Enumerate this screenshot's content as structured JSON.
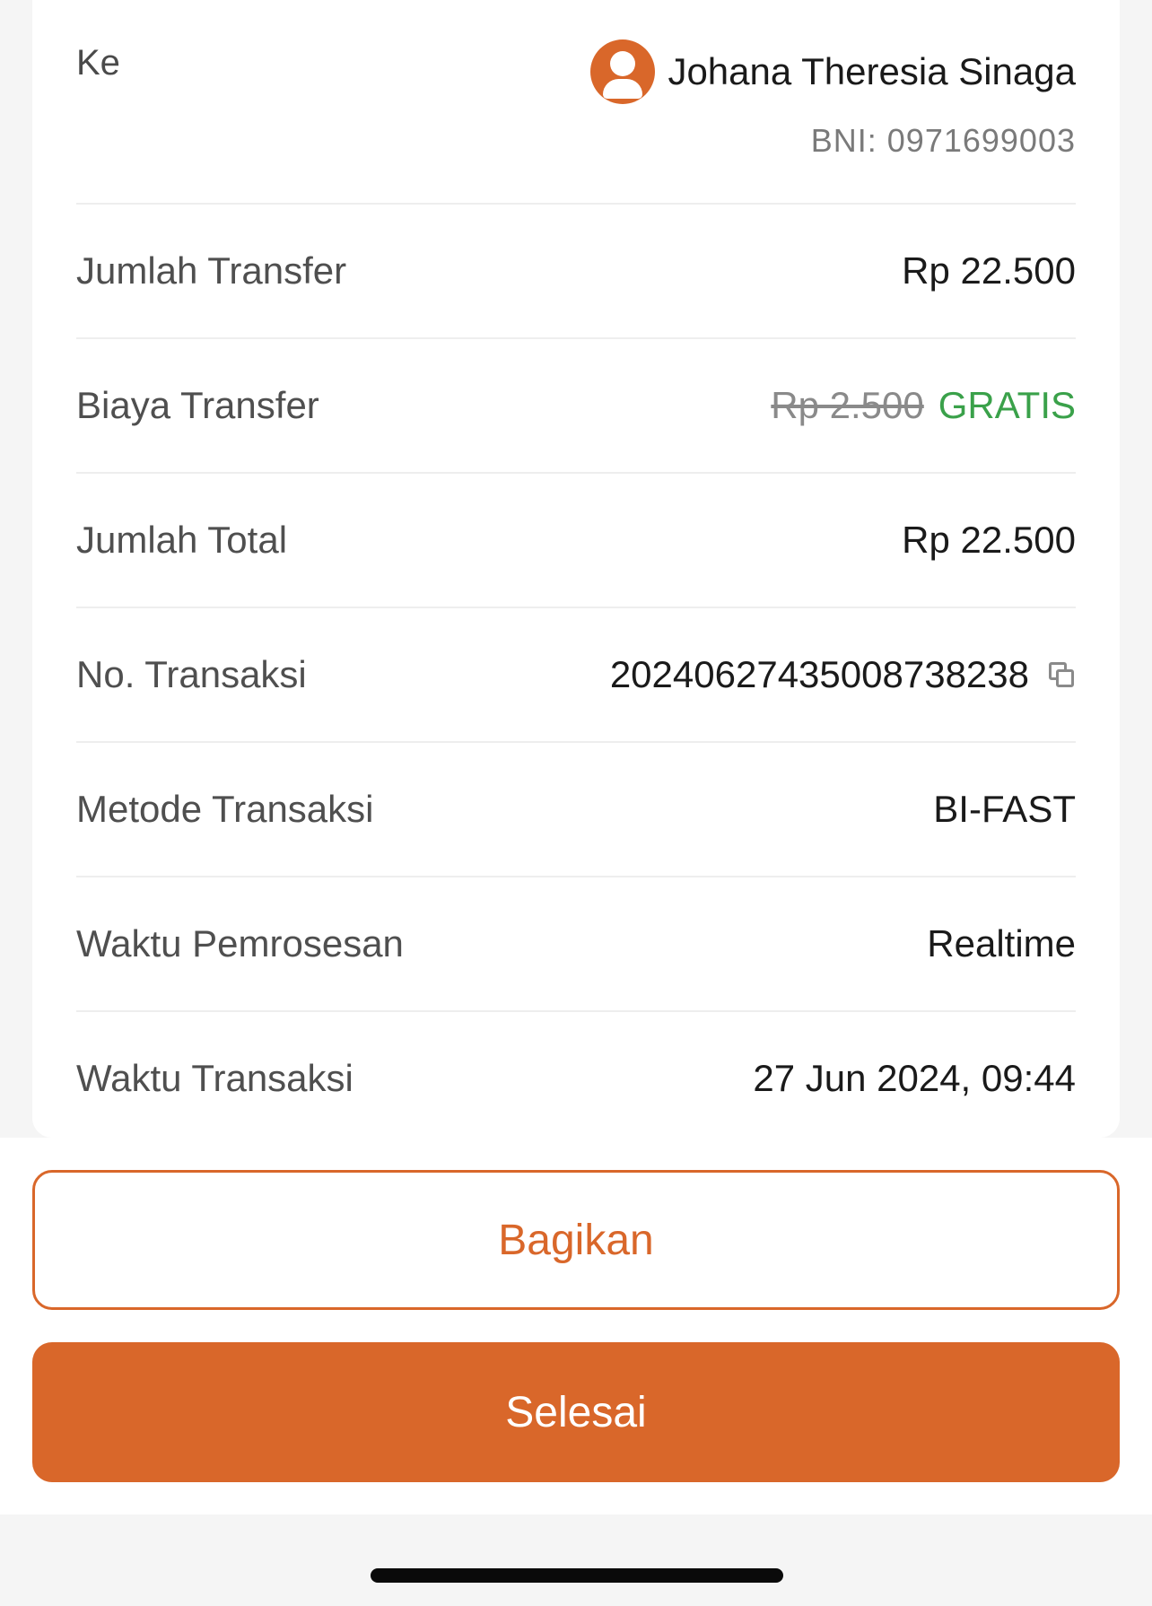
{
  "recipient": {
    "label": "Ke",
    "avatar_icon": "user-icon",
    "name": "Johana Theresia Sinaga",
    "account": "BNI: 0971699003"
  },
  "details": {
    "transfer_amount": {
      "label": "Jumlah Transfer",
      "value": "Rp 22.500"
    },
    "transfer_fee": {
      "label": "Biaya Transfer",
      "original": "Rp 2.500",
      "value": "GRATIS"
    },
    "total_amount": {
      "label": "Jumlah Total",
      "value": "Rp 22.500"
    },
    "transaction_no": {
      "label": "No. Transaksi",
      "value": "20240627435008738238",
      "icon": "copy-icon"
    },
    "method": {
      "label": "Metode Transaksi",
      "value": "BI-FAST"
    },
    "processing_time": {
      "label": "Waktu Pemrosesan",
      "value": "Realtime"
    },
    "transaction_time": {
      "label": "Waktu Transaksi",
      "value": "27 Jun 2024, 09:44"
    }
  },
  "actions": {
    "share_label": "Bagikan",
    "done_label": "Selesai"
  },
  "colors": {
    "accent": "#d9672a",
    "free": "#3aa14a"
  }
}
